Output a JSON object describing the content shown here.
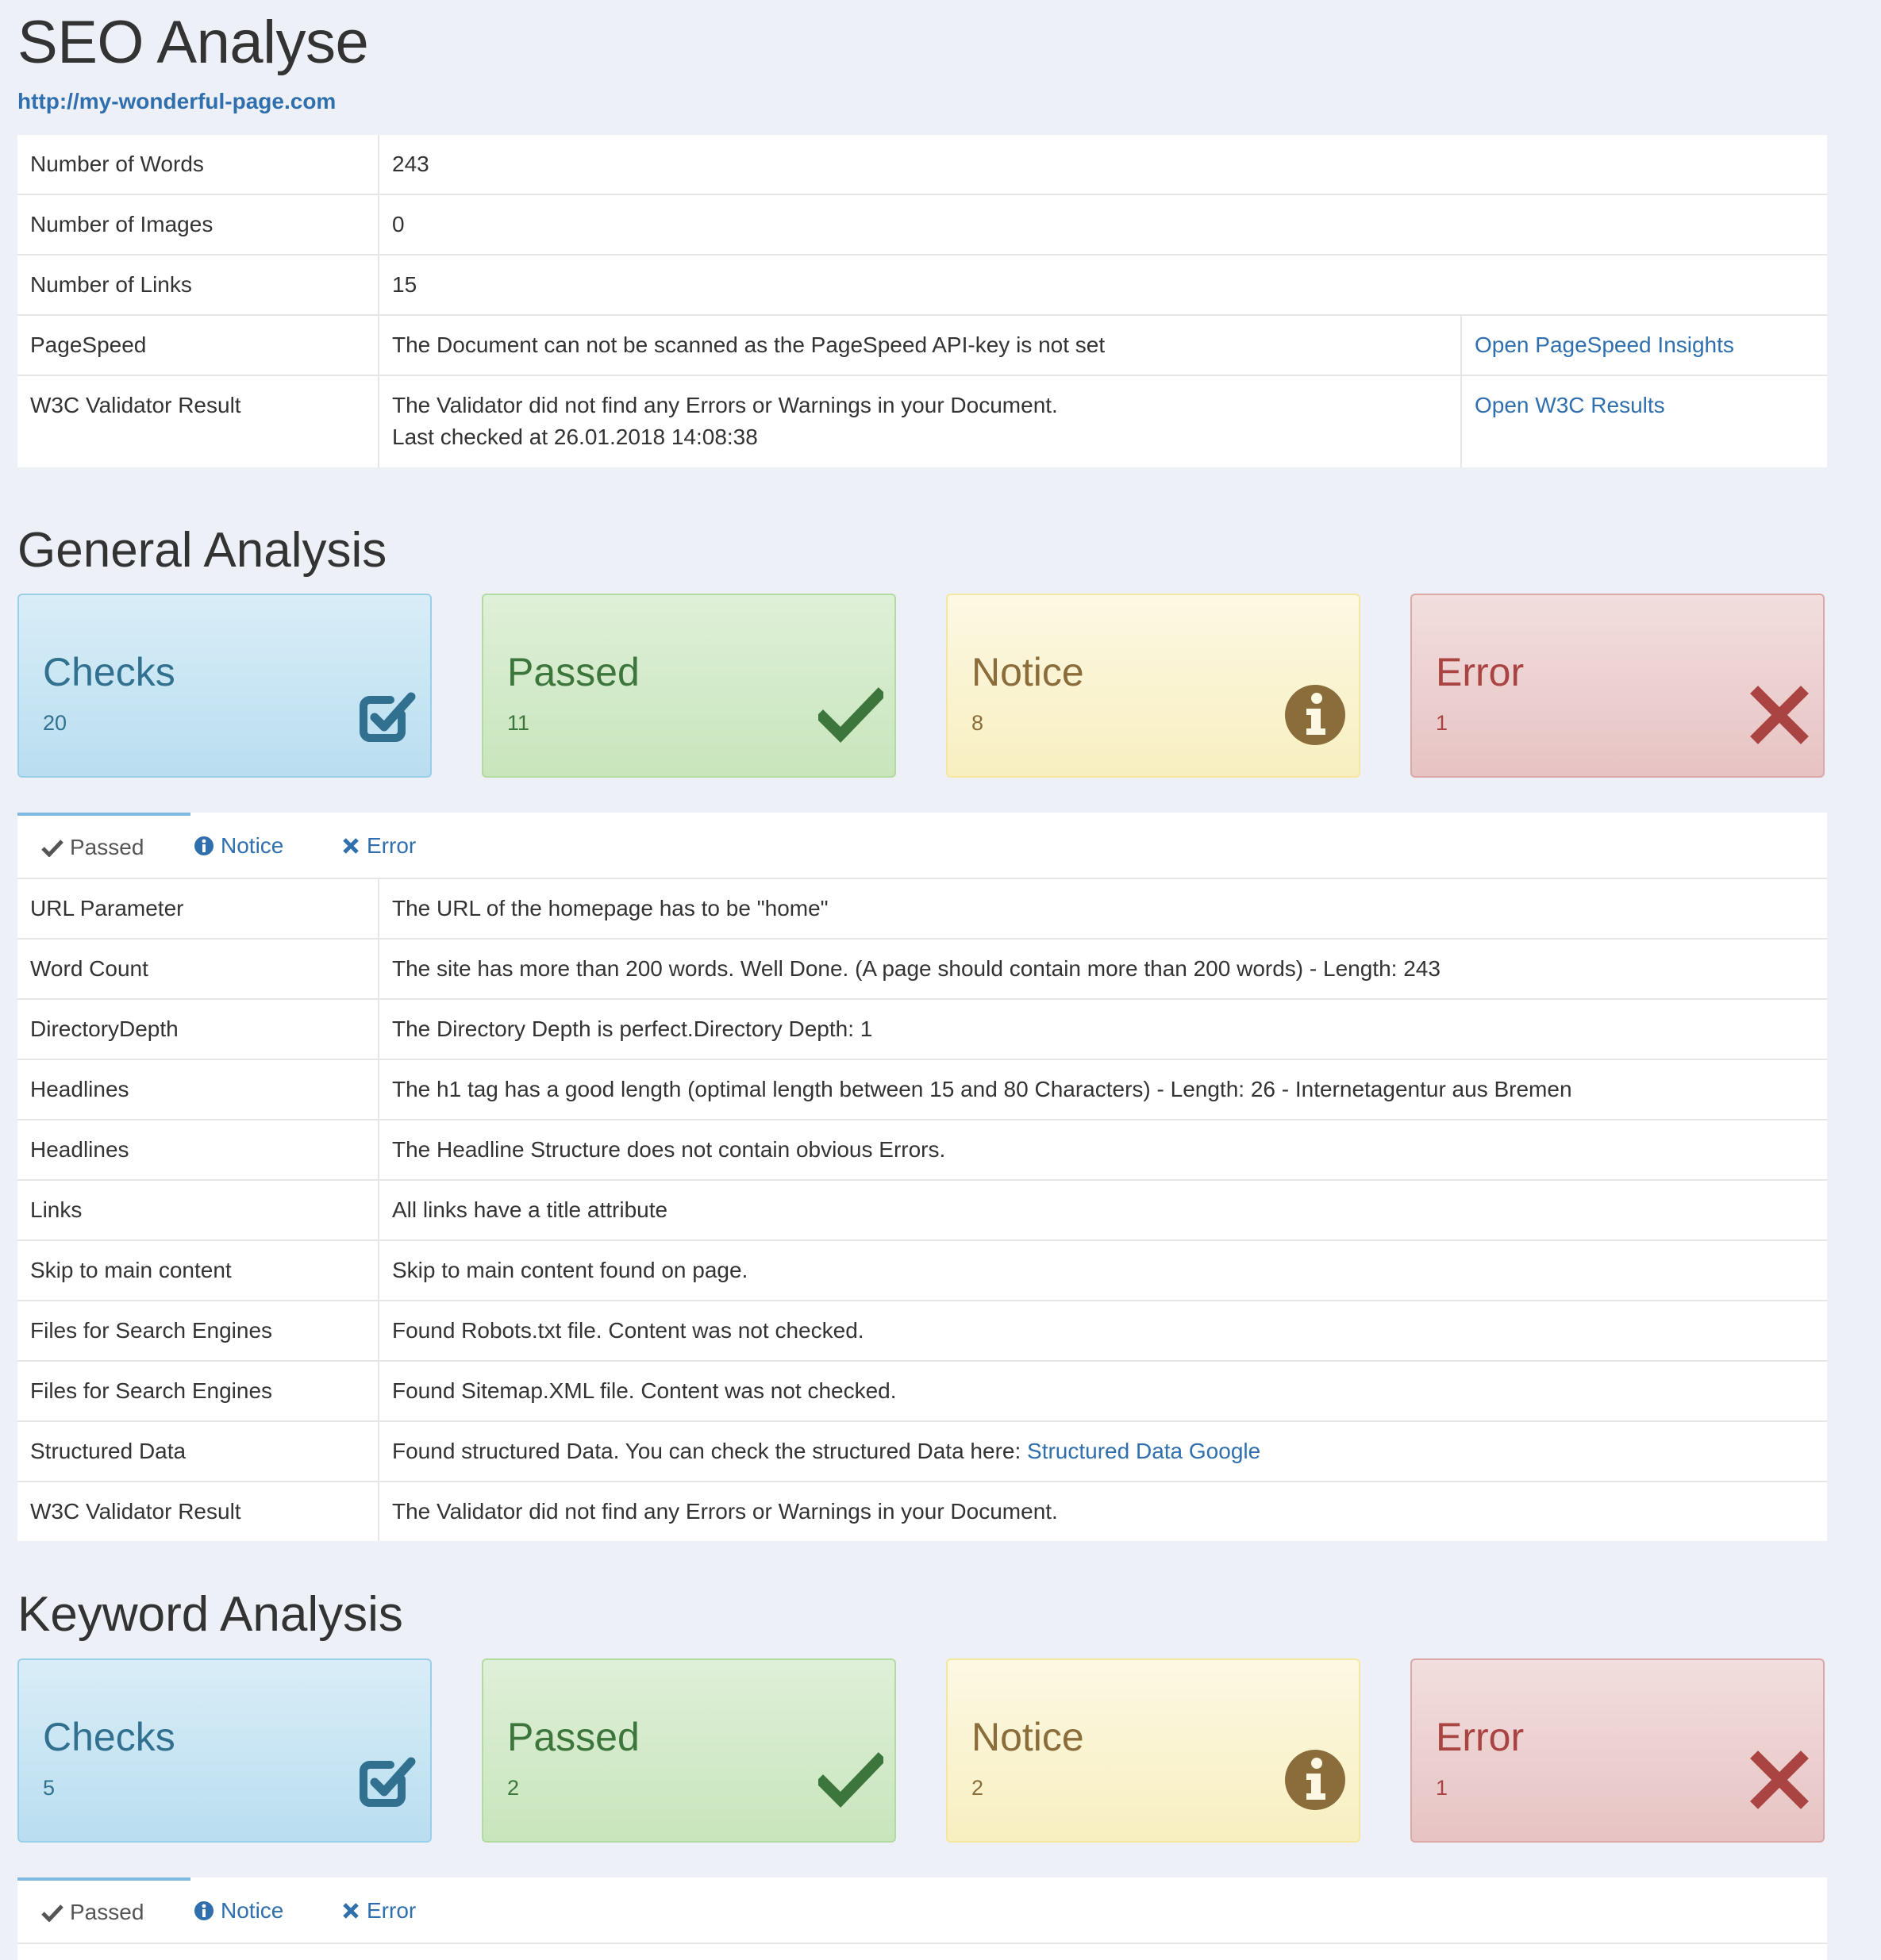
{
  "header": {
    "title": "SEO Analyse",
    "url": "http://my-wonderful-page.com"
  },
  "summary": {
    "rows": [
      {
        "label": "Number of Words",
        "value": "243",
        "link": ""
      },
      {
        "label": "Number of Images",
        "value": "0",
        "link": ""
      },
      {
        "label": "Number of Links",
        "value": "15",
        "link": ""
      },
      {
        "label": "PageSpeed",
        "value": "The Document can not be scanned as the PageSpeed API-key is not set",
        "link": "Open PageSpeed Insights"
      },
      {
        "label": "W3C Validator Result",
        "value": "The Validator did not find any Errors or Warnings in your Document.",
        "value2": "Last checked at 26.01.2018 14:08:38",
        "link": "Open W3C Results"
      }
    ]
  },
  "general": {
    "title": "General Analysis",
    "cards": {
      "checks": {
        "label": "Checks",
        "count": "20"
      },
      "passed": {
        "label": "Passed",
        "count": "11"
      },
      "notice": {
        "label": "Notice",
        "count": "8"
      },
      "error": {
        "label": "Error",
        "count": "1"
      }
    },
    "tabs": {
      "passed": "Passed",
      "notice": "Notice",
      "error": "Error"
    },
    "rows": [
      {
        "label": "URL Parameter",
        "value": "The URL of the homepage has to be \"home\""
      },
      {
        "label": "Word Count",
        "value": "The site has more than 200 words. Well Done. (A page should contain more than 200 words) - Length: 243"
      },
      {
        "label": "DirectoryDepth",
        "value": "The Directory Depth is perfect.Directory Depth: 1"
      },
      {
        "label": "Headlines",
        "value": "The h1 tag has a good length (optimal length between 15 and 80 Characters) - Length: 26 - Internetagentur aus Bremen"
      },
      {
        "label": "Headlines",
        "value": "The Headline Structure does not contain obvious Errors."
      },
      {
        "label": "Links",
        "value": "All links have a title attribute"
      },
      {
        "label": "Skip to main content",
        "value": "Skip to main content found on page."
      },
      {
        "label": "Files for Search Engines",
        "value": "Found Robots.txt file. Content was not checked."
      },
      {
        "label": "Files for Search Engines",
        "value": "Found Sitemap.XML file. Content was not checked."
      },
      {
        "label": "Structured Data",
        "value": "Found structured Data. You can check the structured Data here: ",
        "link": "Structured Data Google"
      },
      {
        "label": "W3C Validator Result",
        "value": "The Validator did not find any Errors or Warnings in your Document."
      }
    ]
  },
  "keyword": {
    "title": "Keyword Analysis",
    "cards": {
      "checks": {
        "label": "Checks",
        "count": "5"
      },
      "passed": {
        "label": "Passed",
        "count": "2"
      },
      "notice": {
        "label": "Notice",
        "count": "2"
      },
      "error": {
        "label": "Error",
        "count": "1"
      }
    },
    "tabs": {
      "passed": "Passed",
      "notice": "Notice",
      "error": "Error"
    }
  },
  "icons": {
    "checks": "checkbox-checked-icon",
    "passed": "checkmark-icon",
    "notice": "info-circle-icon",
    "error": "close-x-icon"
  },
  "colors": {
    "link": "#2f6fad",
    "info": "#31708f",
    "success": "#3c763d",
    "warning": "#8a6d3b",
    "danger": "#a94442"
  }
}
